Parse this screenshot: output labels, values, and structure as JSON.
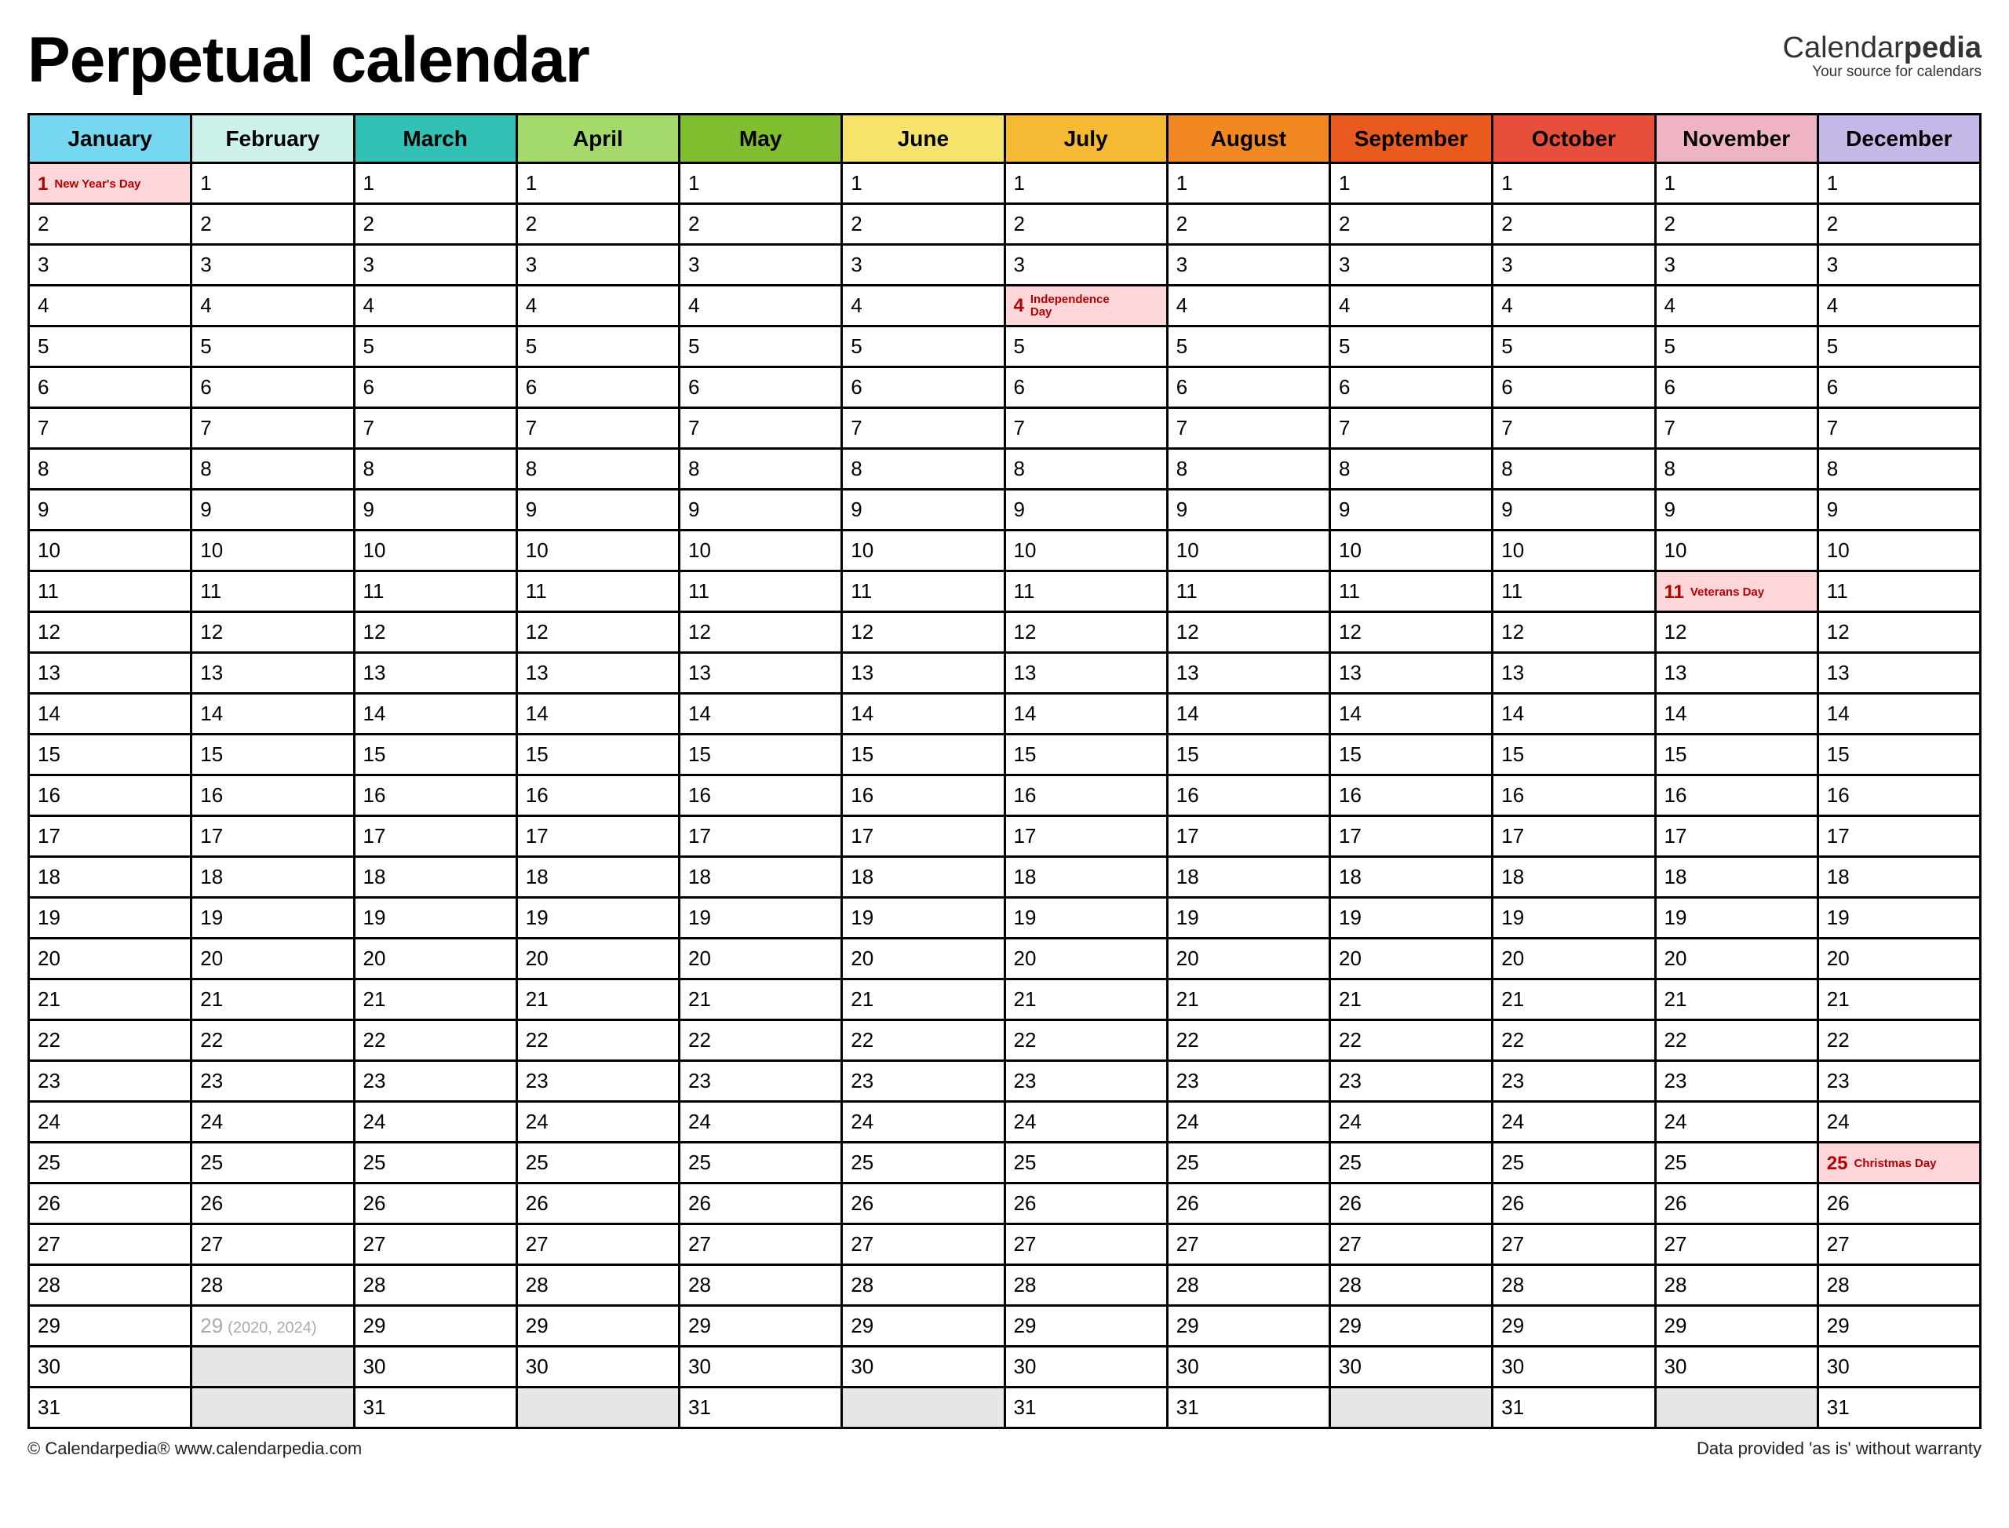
{
  "title": "Perpetual calendar",
  "brand": {
    "cal": "Calendar",
    "pedia": "pedia",
    "tagline": "Your source for calendars"
  },
  "footer": {
    "left": "© Calendarpedia®   www.calendarpedia.com",
    "right": "Data provided 'as is' without warranty"
  },
  "chart_data": {
    "type": "table",
    "months": [
      {
        "name": "January",
        "color": "#76d7f0",
        "days": 31
      },
      {
        "name": "February",
        "color": "#ccf2e9",
        "days": 29,
        "day29_note": "(2020, 2024)"
      },
      {
        "name": "March",
        "color": "#33c1b5",
        "days": 31
      },
      {
        "name": "April",
        "color": "#a4d96b",
        "days": 30
      },
      {
        "name": "May",
        "color": "#7fbe2e",
        "days": 31
      },
      {
        "name": "June",
        "color": "#f6e36b",
        "days": 30
      },
      {
        "name": "July",
        "color": "#f6b933",
        "days": 31
      },
      {
        "name": "August",
        "color": "#f28822",
        "days": 31
      },
      {
        "name": "September",
        "color": "#e85a1d",
        "days": 30
      },
      {
        "name": "October",
        "color": "#e84f3a",
        "days": 31
      },
      {
        "name": "November",
        "color": "#efb4c4",
        "days": 30
      },
      {
        "name": "December",
        "color": "#c5b8e8",
        "days": 31
      }
    ],
    "holidays": [
      {
        "month": 0,
        "day": 1,
        "label": "New Year's Day"
      },
      {
        "month": 6,
        "day": 4,
        "label": "Independence Day"
      },
      {
        "month": 10,
        "day": 11,
        "label": "Veterans Day"
      },
      {
        "month": 11,
        "day": 25,
        "label": "Christmas Day"
      }
    ],
    "rows": 31
  }
}
